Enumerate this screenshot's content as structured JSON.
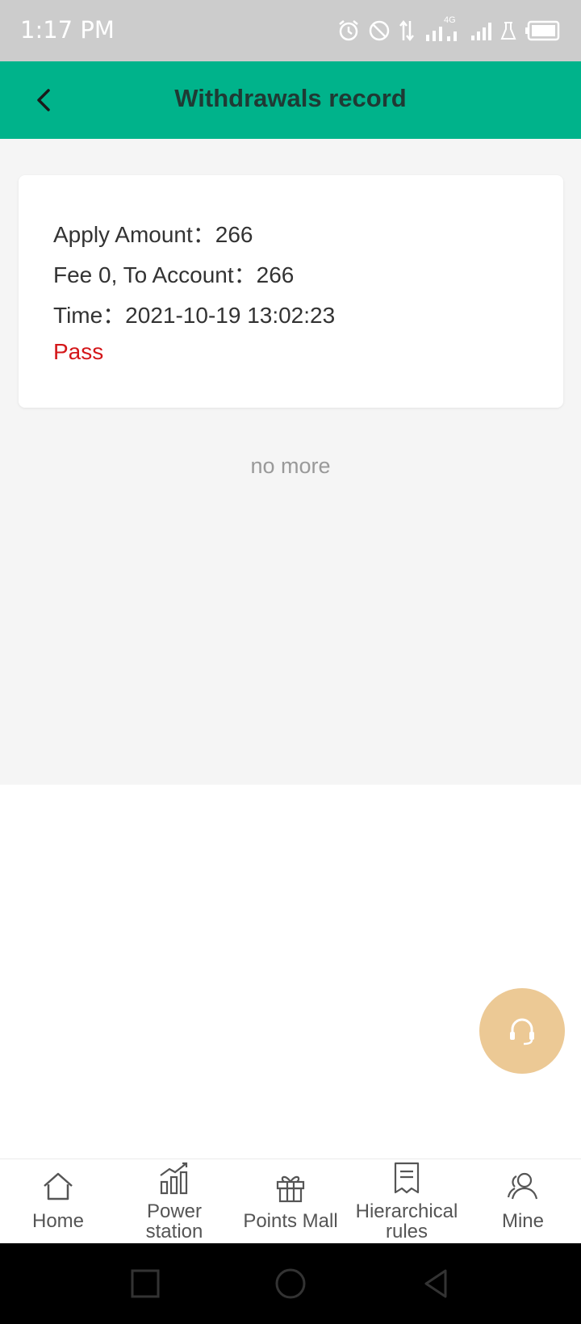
{
  "status_bar": {
    "time": "1:17 PM",
    "network_label": "4G"
  },
  "header": {
    "title": "Withdrawals record"
  },
  "record": {
    "apply_amount": "Apply Amount：266",
    "fee_line": "Fee 0, To Account：266",
    "time_line": "Time：2021-10-19 13:02:23",
    "status": "Pass"
  },
  "list_end_text": "no more",
  "tabs": [
    {
      "label": "Home",
      "icon": "home-icon"
    },
    {
      "label": "Power\nstation",
      "icon": "chart-icon"
    },
    {
      "label": "Points Mall",
      "icon": "gift-icon"
    },
    {
      "label": "Hierarchical\nrules",
      "icon": "document-icon"
    },
    {
      "label": "Mine",
      "icon": "user-icon"
    }
  ],
  "colors": {
    "header_bg": "#00b38b",
    "status_pass": "#d4171a",
    "support_bg": "#ecc995",
    "content_bg": "#f5f5f5"
  }
}
